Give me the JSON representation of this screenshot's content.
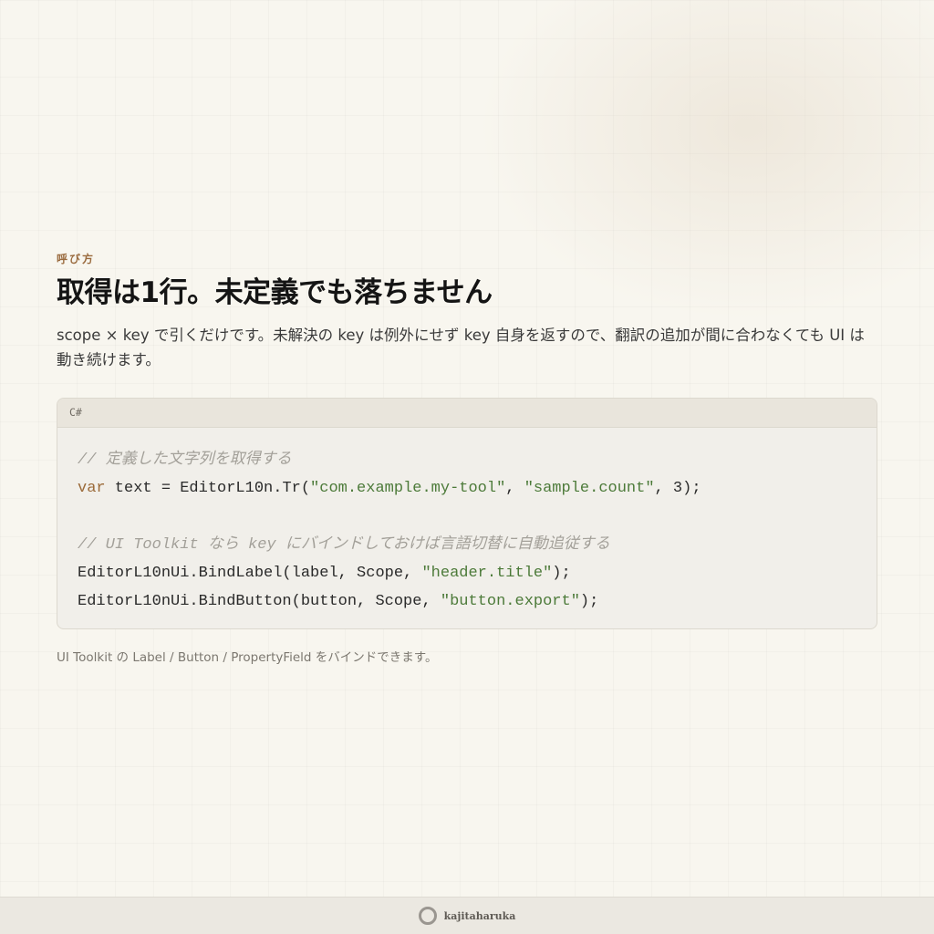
{
  "section": {
    "eyebrow": "呼び方",
    "title": "取得は1行。未定義でも落ちません",
    "lead": "scope × key で引くだけです。未解決の key は例外にせず key 自身を返すので、翻訳の追加が間に合わなくても UI は動き続けます。"
  },
  "code": {
    "language": "C#",
    "comment1": "// 定義した文字列を取得する",
    "line1": {
      "keyword": "var",
      "pre": " text = EditorL10n.Tr(",
      "q1": "\"com.example.my-tool\"",
      "sep": ", ",
      "q2": "\"sample.count\"",
      "post": ", 3);"
    },
    "comment2": "// UI Toolkit なら key にバインドしておけば言語切替に自動追従する",
    "line2": {
      "pre": "EditorL10nUi.BindLabel(label, Scope, ",
      "str": "\"header.title\"",
      "post": ");"
    },
    "line3": {
      "pre": "EditorL10nUi.BindButton(button, Scope, ",
      "str": "\"button.export\"",
      "post": ");"
    }
  },
  "caption": "UI Toolkit の Label / Button / PropertyField をバインドできます。",
  "footer": {
    "brand": "kajitaharuka",
    "icon": "ring-logo-icon"
  }
}
